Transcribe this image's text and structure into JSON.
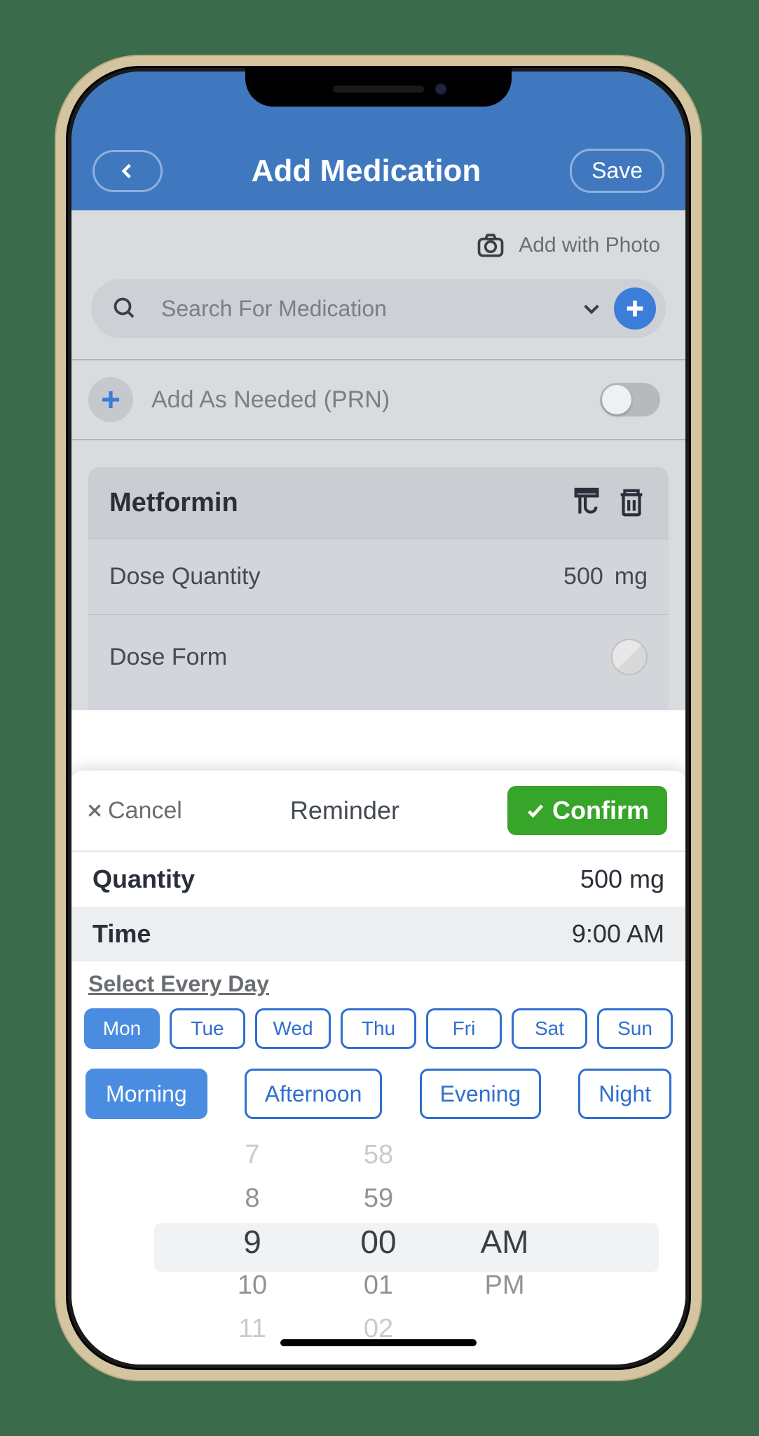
{
  "header": {
    "title": "Add Medication",
    "save": "Save"
  },
  "addPhoto": "Add with Photo",
  "searchPlaceholder": "Search For Medication",
  "prnLabel": "Add As Needed (PRN)",
  "med": {
    "name": "Metformin",
    "doseQtyLabel": "Dose Quantity",
    "doseQtyValue": "500",
    "doseQtyUnit": "mg",
    "doseFormLabel": "Dose Form"
  },
  "sheet": {
    "cancel": "Cancel",
    "title": "Reminder",
    "confirm": "Confirm",
    "quantityLabel": "Quantity",
    "quantityValue": "500 mg",
    "timeLabel": "Time",
    "timeValue": "9:00 AM",
    "selectEvery": "Select Every Day",
    "days": [
      "Mon",
      "Tue",
      "Wed",
      "Thu",
      "Fri",
      "Sat",
      "Sun"
    ],
    "daySelected": 0,
    "parts": [
      "Morning",
      "Afternoon",
      "Evening",
      "Night"
    ],
    "partSelected": 0,
    "picker": {
      "hours": [
        "7",
        "8",
        "9",
        "10",
        "11"
      ],
      "minutes": [
        "58",
        "59",
        "00",
        "01",
        "02"
      ],
      "periods": [
        "AM",
        "PM"
      ]
    }
  }
}
